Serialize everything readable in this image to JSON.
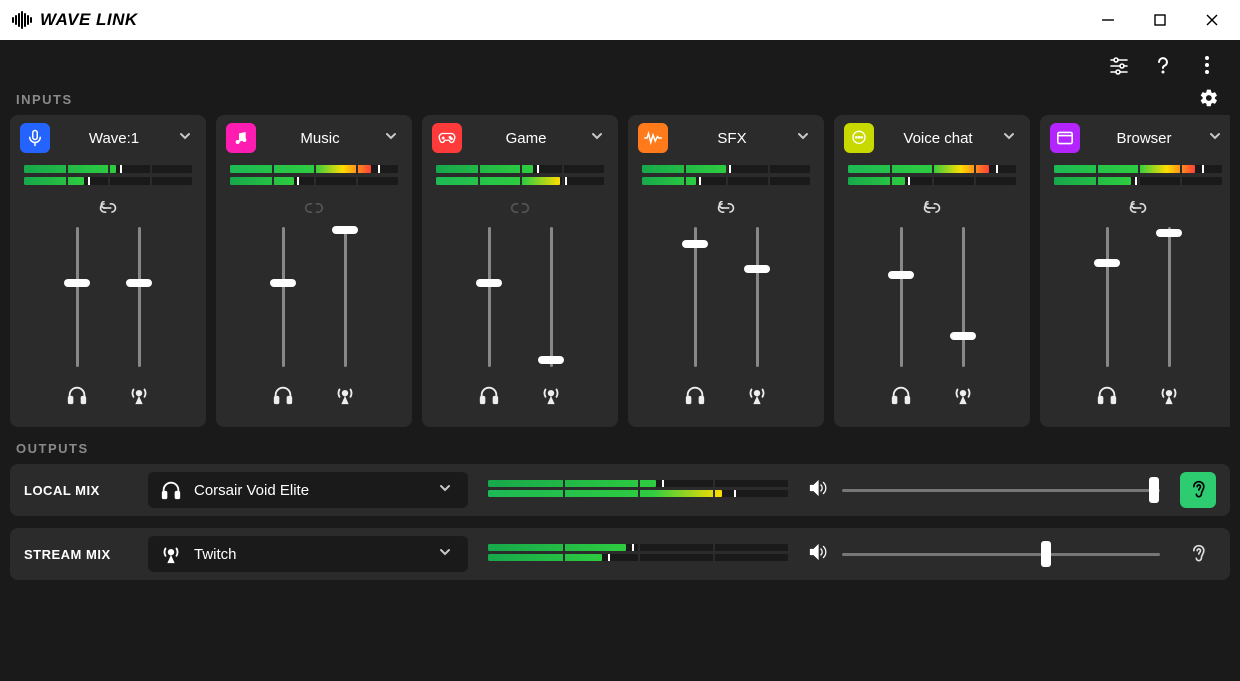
{
  "app_title": "WAVE LINK",
  "sections": {
    "inputs": "INPUTS",
    "outputs": "OUTPUTS"
  },
  "output_labels": {
    "local": "LOCAL MIX",
    "stream": "STREAM MIX"
  },
  "channels": [
    {
      "id": "wave1",
      "name": "Wave:1",
      "color": "#2563ff",
      "icon": "mic",
      "linked": true,
      "meters": [
        {
          "level": 55,
          "peak": 57,
          "grad": "g"
        },
        {
          "level": 36,
          "peak": 38,
          "grad": "g"
        }
      ],
      "faders": [
        60,
        60
      ]
    },
    {
      "id": "music",
      "name": "Music",
      "color": "#ff1cb1",
      "icon": "music-note",
      "linked": false,
      "meters": [
        {
          "level": 84,
          "peak": 88,
          "grad": "gyr"
        },
        {
          "level": 38,
          "peak": 40,
          "grad": "g"
        }
      ],
      "faders": [
        60,
        98
      ]
    },
    {
      "id": "game",
      "name": "Game",
      "color": "#ff3a3a",
      "icon": "gamepad",
      "linked": false,
      "meters": [
        {
          "level": 58,
          "peak": 60,
          "grad": "g"
        },
        {
          "level": 74,
          "peak": 77,
          "grad": "gy"
        }
      ],
      "faders": [
        60,
        5
      ]
    },
    {
      "id": "sfx",
      "name": "SFX",
      "color": "#ff7a1a",
      "icon": "waveform",
      "linked": true,
      "meters": [
        {
          "level": 50,
          "peak": 52,
          "grad": "g"
        },
        {
          "level": 32,
          "peak": 34,
          "grad": "g"
        }
      ],
      "faders": [
        88,
        70
      ]
    },
    {
      "id": "voice",
      "name": "Voice chat",
      "color": "#c8d900",
      "icon": "chat",
      "linked": true,
      "meters": [
        {
          "level": 84,
          "peak": 88,
          "grad": "gyr"
        },
        {
          "level": 34,
          "peak": 36,
          "grad": "g"
        }
      ],
      "faders": [
        66,
        22
      ]
    },
    {
      "id": "browser",
      "name": "Browser",
      "color": "#b324ff",
      "icon": "window",
      "linked": true,
      "meters": [
        {
          "level": 84,
          "peak": 88,
          "grad": "gyr"
        },
        {
          "level": 46,
          "peak": 48,
          "grad": "g"
        }
      ],
      "faders": [
        74,
        96
      ]
    }
  ],
  "outputs": {
    "local": {
      "device": "Corsair Void Elite",
      "icon": "headphones",
      "meters": [
        {
          "level": 56,
          "peak": 58,
          "grad": "g"
        },
        {
          "level": 78,
          "peak": 82,
          "grad": "gy"
        }
      ],
      "volume": 98,
      "monitor": true
    },
    "stream": {
      "device": "Twitch",
      "icon": "broadcast",
      "meters": [
        {
          "level": 46,
          "peak": 48,
          "grad": "g"
        },
        {
          "level": 38,
          "peak": 40,
          "grad": "g"
        }
      ],
      "volume": 64,
      "monitor": false
    }
  }
}
